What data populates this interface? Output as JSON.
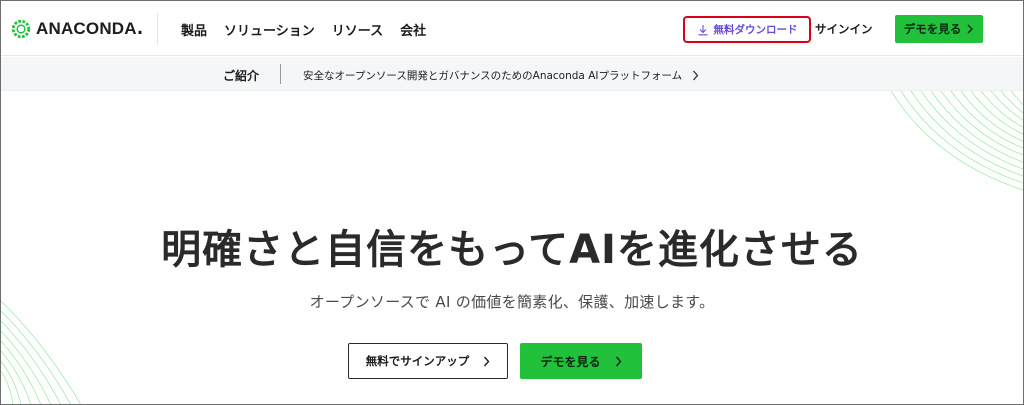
{
  "brand": {
    "name": "ANACONDA",
    "accent": "#21c13b",
    "highlight": "#d9001b"
  },
  "header": {
    "nav": [
      "製品",
      "ソリューション",
      "リソース",
      "会社"
    ],
    "download_label": "無料ダウンロード",
    "signin_label": "サインイン",
    "demo_label": "デモを見る"
  },
  "announcement": {
    "intro": "ご紹介",
    "text": "安全なオープンソース開発とガバナンスのためのAnaconda AIプラットフォーム"
  },
  "hero": {
    "title": "明確さと自信をもってAIを進化させる",
    "subtitle": "オープンソースで AI の価値を簡素化、保護、加速します。",
    "signup_label": "無料でサインアップ",
    "demo_label": "デモを見る"
  },
  "icons": [
    "anaconda-logo-icon",
    "download-icon",
    "chevron-right-icon"
  ]
}
